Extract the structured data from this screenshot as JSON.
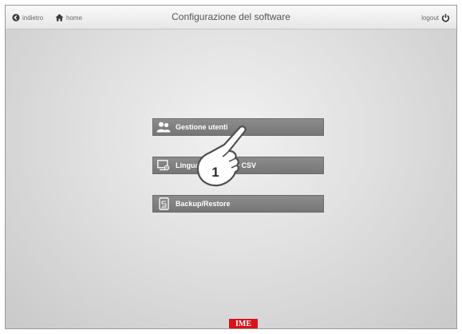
{
  "header": {
    "back_label": "indietro",
    "home_label": "home",
    "title": "Configurazione del software",
    "logout_label": "logout"
  },
  "menu": {
    "items": [
      {
        "label": "Gestione utenti",
        "icon": "users-icon"
      },
      {
        "label": "Lingua / lettura file CSV",
        "icon": "monitor-settings-icon"
      },
      {
        "label": "Backup/Restore",
        "icon": "tablet-icon"
      }
    ]
  },
  "callout": {
    "number": "1",
    "icon": "pointing-hand-icon"
  },
  "footer": {
    "logo_text": "IME",
    "logo_color": "#d6141c"
  }
}
